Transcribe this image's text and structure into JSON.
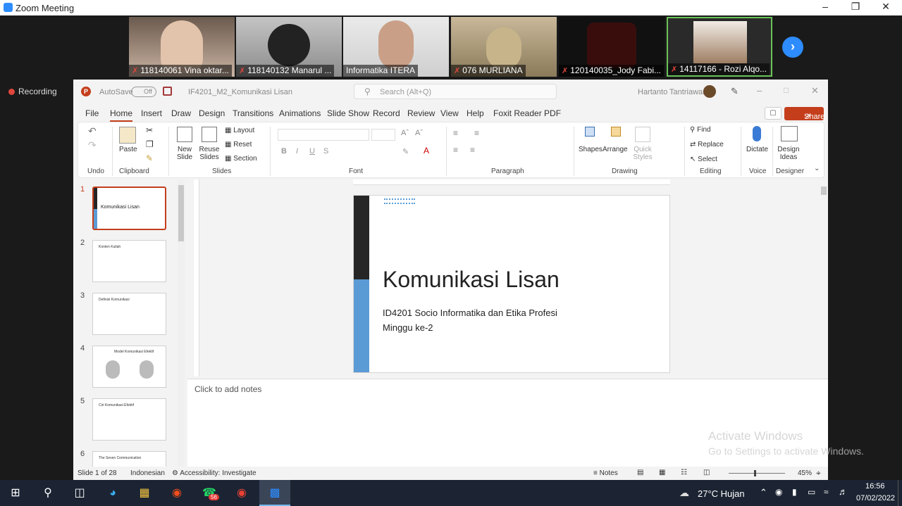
{
  "zoom": {
    "window_title": "Zoom Meeting",
    "recording_label": "Recording",
    "participants": [
      {
        "name": "118140061 Vina oktar...",
        "muted": true
      },
      {
        "name": "118140132 Manarul ...",
        "muted": true
      },
      {
        "name": "Informatika ITERA",
        "muted": false
      },
      {
        "name": "076 MURLIANA",
        "muted": true
      },
      {
        "name": "120140035_Jody Fabi...",
        "muted": true
      },
      {
        "name": "14117166 - Rozi Alqo...",
        "muted": true
      }
    ],
    "next_icon": "chevron-right-icon"
  },
  "ppt": {
    "autosave_label": "AutoSave",
    "autosave_state": "Off",
    "file_name": "IF4201_M2_Komunikasi Lisan",
    "search_placeholder": "Search (Alt+Q)",
    "user_name": "Hartanto Tantriawan",
    "tabs": [
      "File",
      "Home",
      "Insert",
      "Draw",
      "Design",
      "Transitions",
      "Animations",
      "Slide Show",
      "Record",
      "Review",
      "View",
      "Help",
      "Foxit Reader PDF"
    ],
    "active_tab": "Home",
    "share_label": "Share",
    "ribbon": {
      "undo_group": "Undo",
      "paste": "Paste",
      "clipboard_group": "Clipboard",
      "new_slide": "New Slide",
      "reuse_slides": "Reuse Slides",
      "layout": "Layout",
      "reset": "Reset",
      "section": "Section",
      "slides_group": "Slides",
      "font_group": "Font",
      "paragraph_group": "Paragraph",
      "shapes": "Shapes",
      "arrange": "Arrange",
      "quick_styles": "Quick Styles",
      "drawing_group": "Drawing",
      "find": "Find",
      "replace": "Replace",
      "select": "Select",
      "editing_group": "Editing",
      "dictate": "Dictate",
      "voice_group": "Voice",
      "design_ideas": "Design Ideas",
      "designer_group": "Designer"
    },
    "slides": [
      {
        "num": "1",
        "title": "Komunikasi Lisan"
      },
      {
        "num": "2",
        "title": "Konten Kuliah"
      },
      {
        "num": "3",
        "title": "Definisi Komunikasi"
      },
      {
        "num": "4",
        "title": "Model Komunikasi Efektif"
      },
      {
        "num": "5",
        "title": "Ciri Komunikasi Efektif"
      },
      {
        "num": "6",
        "title": "The Seven Communication"
      }
    ],
    "current_slide": {
      "title": "Komunikasi Lisan",
      "subtitle_line1": "ID4201 Socio Informatika dan Etika Profesi",
      "subtitle_line2": "Minggu ke-2"
    },
    "notes_placeholder": "Click to add notes",
    "status": {
      "slide_of": "Slide 1 of 28",
      "language": "Indonesian",
      "accessibility": "Accessibility: Investigate",
      "notes": "Notes",
      "zoom": "45%"
    }
  },
  "watermark": {
    "line1": "Activate Windows",
    "line2": "Go to Settings to activate Windows."
  },
  "taskbar": {
    "weather": "27°C  Hujan",
    "time": "16:56",
    "date": "07/02/2022",
    "whatsapp_badge": "56"
  },
  "colors": {
    "zoom_blue": "#2d8cff",
    "ppt_red": "#c43e1c",
    "slide_accent_blue": "#5b9bd5",
    "slide_dark_bar": "#262626"
  }
}
